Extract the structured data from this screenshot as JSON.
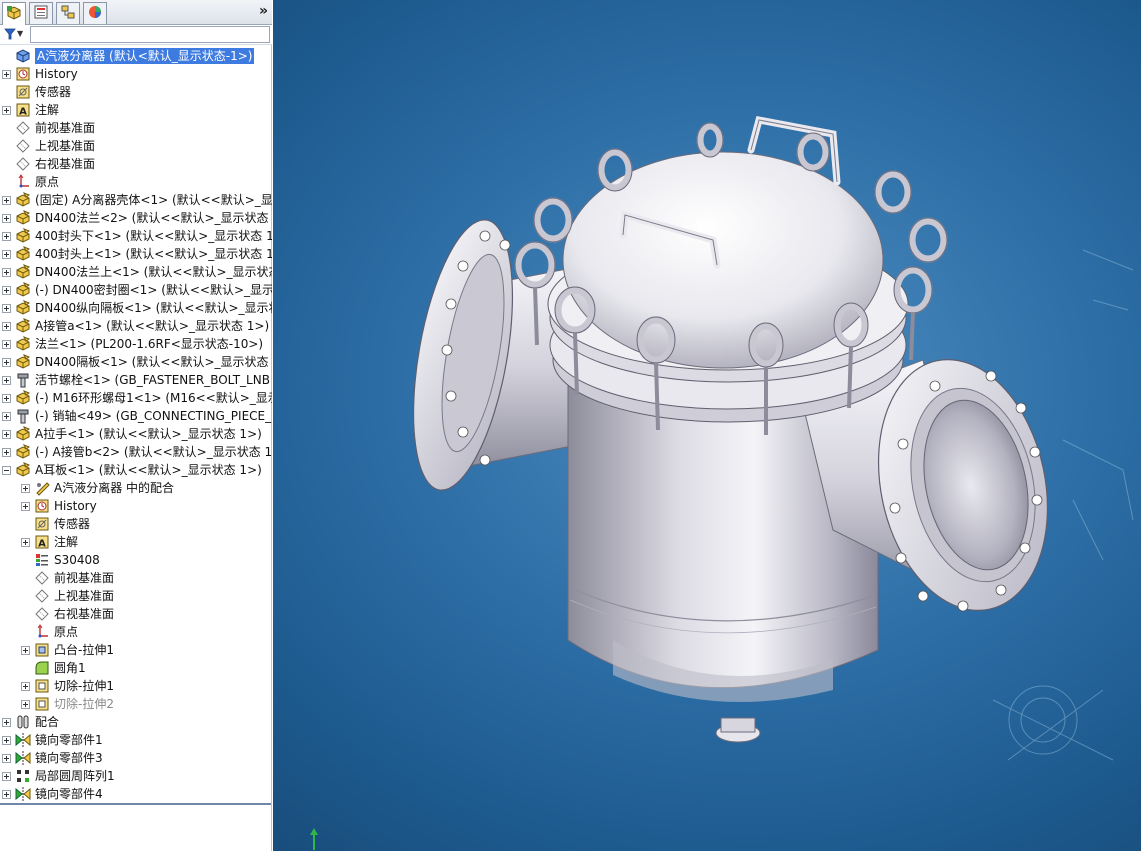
{
  "tabs": [
    {
      "name": "featuremanager-tab",
      "icon": "featuremanager-icon"
    },
    {
      "name": "propertymanager-tab",
      "icon": "propertymanager-icon"
    },
    {
      "name": "configurationmanager-tab",
      "icon": "configurationmanager-icon"
    },
    {
      "name": "displaymanager-tab",
      "icon": "displaymanager-icon"
    }
  ],
  "more_tabs_label": "»",
  "tree": [
    {
      "label": "A汽液分离器  (默认<默认_显示状态-1>)",
      "icon": "assembly",
      "indent": 0,
      "expander": "none",
      "selected": true
    },
    {
      "label": "History",
      "icon": "history",
      "indent": 0,
      "expander": "plus"
    },
    {
      "label": "传感器",
      "icon": "sensor",
      "indent": 0,
      "expander": "none"
    },
    {
      "label": "注解",
      "icon": "annotation",
      "indent": 0,
      "expander": "plus"
    },
    {
      "label": "前视基准面",
      "icon": "plane",
      "indent": 0,
      "expander": "none"
    },
    {
      "label": "上视基准面",
      "icon": "plane",
      "indent": 0,
      "expander": "none"
    },
    {
      "label": "右视基准面",
      "icon": "plane",
      "indent": 0,
      "expander": "none"
    },
    {
      "label": "原点",
      "icon": "origin",
      "indent": 0,
      "expander": "none"
    },
    {
      "label": "(固定) A分离器壳体<1> (默认<<默认>_显示",
      "icon": "part",
      "indent": 0,
      "expander": "plus"
    },
    {
      "label": "DN400法兰<2> (默认<<默认>_显示状态 1",
      "icon": "part",
      "indent": 0,
      "expander": "plus"
    },
    {
      "label": "400封头下<1> (默认<<默认>_显示状态 1>",
      "icon": "part",
      "indent": 0,
      "expander": "plus"
    },
    {
      "label": "400封头上<1> (默认<<默认>_显示状态 1>",
      "icon": "part",
      "indent": 0,
      "expander": "plus"
    },
    {
      "label": "DN400法兰上<1> (默认<<默认>_显示状态",
      "icon": "part",
      "indent": 0,
      "expander": "plus"
    },
    {
      "label": "(-) DN400密封圈<1> (默认<<默认>_显示状",
      "icon": "part",
      "indent": 0,
      "expander": "plus"
    },
    {
      "label": "DN400纵向隔板<1> (默认<<默认>_显示状",
      "icon": "part",
      "indent": 0,
      "expander": "plus"
    },
    {
      "label": "A接管a<1> (默认<<默认>_显示状态 1>)",
      "icon": "part",
      "indent": 0,
      "expander": "plus"
    },
    {
      "label": "法兰<1> (PL200-1.6RF<显示状态-10>)",
      "icon": "part",
      "indent": 0,
      "expander": "plus"
    },
    {
      "label": "DN400隔板<1> (默认<<默认>_显示状态 1",
      "icon": "part",
      "indent": 0,
      "expander": "plus"
    },
    {
      "label": "活节螺栓<1> (GB_FASTENER_BOLT_LNB I",
      "icon": "toolbox",
      "indent": 0,
      "expander": "plus"
    },
    {
      "label": "(-) M16环形螺母1<1> (M16<<默认>_显示",
      "icon": "part",
      "indent": 0,
      "expander": "plus"
    },
    {
      "label": "(-) 销轴<49> (GB_CONNECTING_PIECE_P",
      "icon": "toolbox",
      "indent": 0,
      "expander": "plus"
    },
    {
      "label": "A拉手<1> (默认<<默认>_显示状态 1>)",
      "icon": "part",
      "indent": 0,
      "expander": "plus"
    },
    {
      "label": "(-) A接管b<2> (默认<<默认>_显示状态 1>",
      "icon": "part",
      "indent": 0,
      "expander": "plus"
    },
    {
      "label": "A耳板<1> (默认<<默认>_显示状态 1>)",
      "icon": "part",
      "indent": 0,
      "expander": "minus"
    },
    {
      "label": "A汽液分离器 中的配合",
      "icon": "mates-in",
      "indent": 1,
      "expander": "plus"
    },
    {
      "label": "History",
      "icon": "history",
      "indent": 1,
      "expander": "plus"
    },
    {
      "label": "传感器",
      "icon": "sensor",
      "indent": 1,
      "expander": "none"
    },
    {
      "label": "注解",
      "icon": "annotation",
      "indent": 1,
      "expander": "plus"
    },
    {
      "label": "S30408",
      "icon": "material",
      "indent": 1,
      "expander": "none"
    },
    {
      "label": "前视基准面",
      "icon": "plane",
      "indent": 1,
      "expander": "none"
    },
    {
      "label": "上视基准面",
      "icon": "plane",
      "indent": 1,
      "expander": "none"
    },
    {
      "label": "右视基准面",
      "icon": "plane",
      "indent": 1,
      "expander": "none"
    },
    {
      "label": "原点",
      "icon": "origin",
      "indent": 1,
      "expander": "none"
    },
    {
      "label": "凸台-拉伸1",
      "icon": "boss-extrude",
      "indent": 1,
      "expander": "plus"
    },
    {
      "label": "圆角1",
      "icon": "fillet",
      "indent": 1,
      "expander": "none"
    },
    {
      "label": "切除-拉伸1",
      "icon": "cut-extrude",
      "indent": 1,
      "expander": "plus"
    },
    {
      "label": "切除-拉伸2",
      "icon": "cut-extrude",
      "indent": 1,
      "expander": "plus",
      "dim": true
    },
    {
      "label": "配合",
      "icon": "mates",
      "indent": 0,
      "expander": "plus"
    },
    {
      "label": "镜向零部件1",
      "icon": "mirror",
      "indent": 0,
      "expander": "plus"
    },
    {
      "label": "镜向零部件3",
      "icon": "mirror",
      "indent": 0,
      "expander": "plus"
    },
    {
      "label": "局部圆周阵列1",
      "icon": "pattern",
      "indent": 0,
      "expander": "plus"
    },
    {
      "label": "镜向零部件4",
      "icon": "mirror",
      "indent": 0,
      "expander": "plus"
    }
  ],
  "colors": {
    "selection": "#3d7be0",
    "viewport_center": "#4f8fc2",
    "viewport_edge": "#174a78",
    "part_icon": "#e8c23a"
  }
}
